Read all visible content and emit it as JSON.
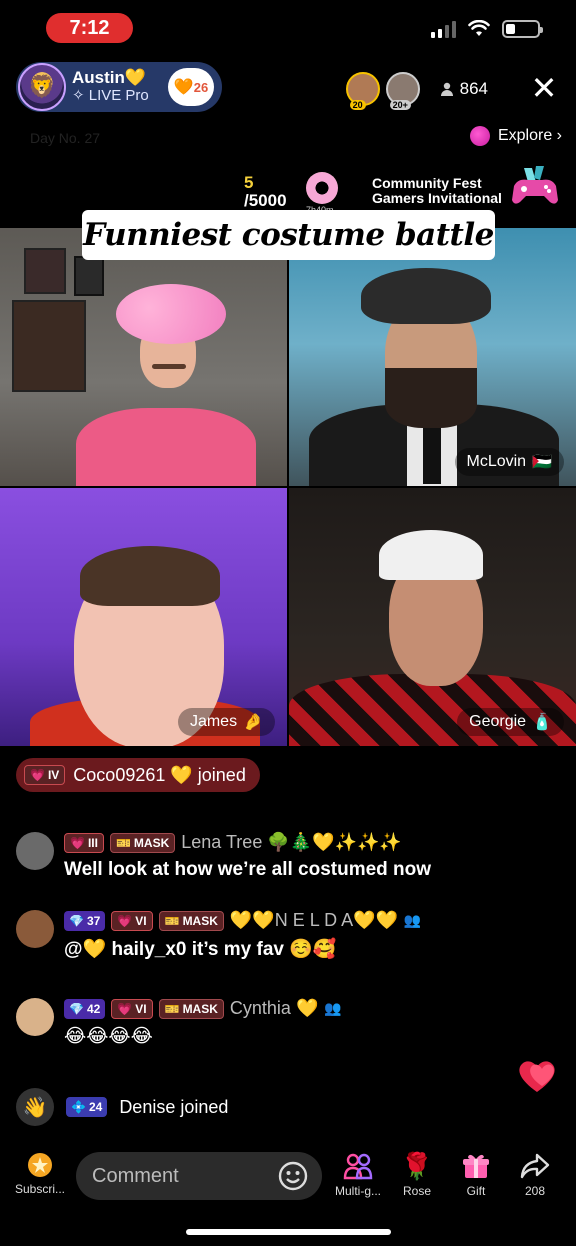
{
  "status": {
    "time": "7:12"
  },
  "host": {
    "name": "Austin💛",
    "subtitle": "✧ LIVE Pro",
    "heart_count": "26"
  },
  "viewers": {
    "count": "864",
    "avatar_levels": [
      "20",
      "20+"
    ]
  },
  "top": {
    "day_label": "Day No. 27",
    "explore_label": "Explore ›"
  },
  "goal": {
    "current": "5",
    "target": "/5000",
    "timer": "7h40m"
  },
  "fest": {
    "line1": "Community Fest",
    "line2": "Gamers Invitational"
  },
  "battle_title": "Funniest costume battle",
  "tiles": [
    {
      "label": "",
      "flag": ""
    },
    {
      "label": "McLovin",
      "flag": "🇵🇸"
    },
    {
      "label": "James",
      "flag": "🤌"
    },
    {
      "label": "Georgie",
      "flag": "🧴"
    }
  ],
  "joined_banner": {
    "badge": "IV",
    "text": "Coco09261 💛 joined"
  },
  "comments": [
    {
      "badges": [
        {
          "type": "heart",
          "text": "III"
        },
        {
          "type": "mask",
          "text": "MASK"
        }
      ],
      "name": "Lena Tree 🌳🎄💛✨✨✨",
      "message": "Well look at how we’re all costumed now",
      "avatar_color": "#777"
    },
    {
      "badges": [
        {
          "type": "gem",
          "text": "37"
        },
        {
          "type": "heart",
          "text": "VI"
        },
        {
          "type": "mask",
          "text": "MASK"
        }
      ],
      "name": "💛💛N E L D A💛💛",
      "message": "@💛 haily_x0 it’s my fav ☺️🥰",
      "avatar_color": "#8a5a3a"
    },
    {
      "badges": [
        {
          "type": "gem",
          "text": "42"
        },
        {
          "type": "heart",
          "text": "VI"
        },
        {
          "type": "mask",
          "text": "MASK"
        }
      ],
      "name": "Cynthia 💛",
      "message": "😂😂😂😂",
      "avatar_color": "#d9b28a"
    }
  ],
  "denise": {
    "badge": "24",
    "text": "Denise joined"
  },
  "bottom": {
    "subscribe": "Subscri...",
    "comment_placeholder": "Comment",
    "multi": "Multi-g...",
    "rose": "Rose",
    "gift": "Gift",
    "share_count": "208"
  }
}
